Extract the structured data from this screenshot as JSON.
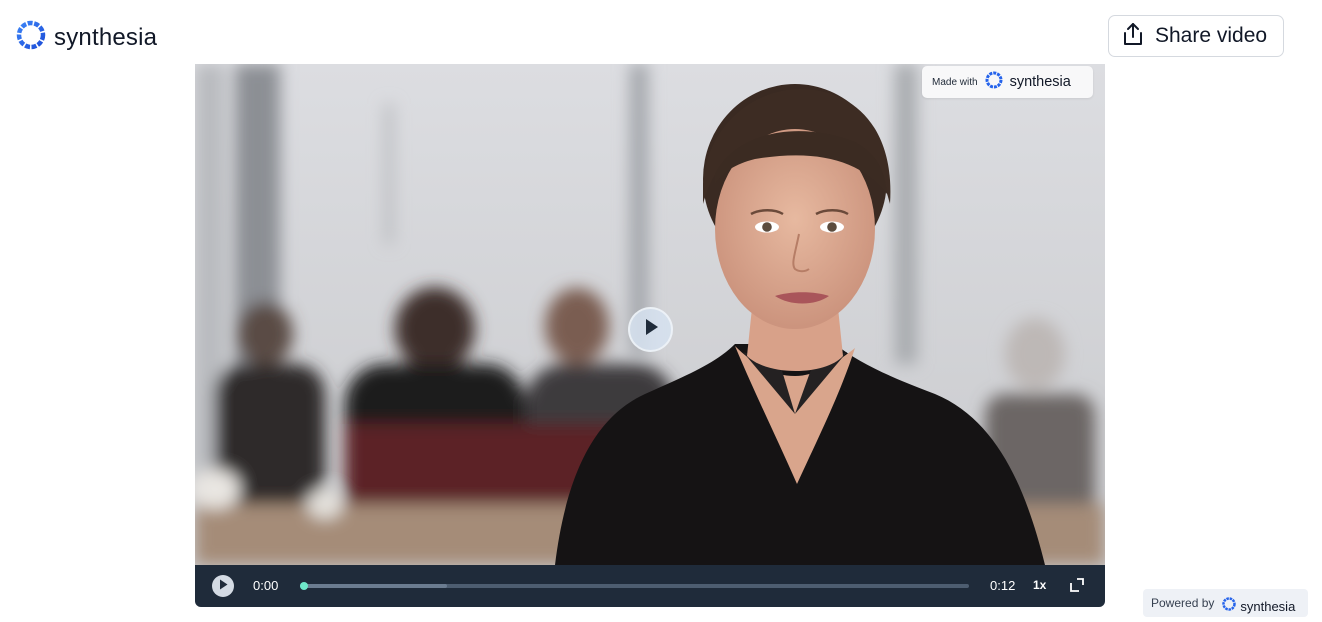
{
  "header": {
    "brand": "synthesia",
    "share_label": "Share video"
  },
  "video": {
    "watermark_prefix": "Made with",
    "watermark_brand": "synthesia",
    "current_time": "0:00",
    "duration": "0:12",
    "speed": "1x",
    "progress_fraction": 0.0,
    "buffered_fraction": 0.22
  },
  "footer": {
    "powered_label": "Powered by",
    "powered_brand": "synthesia"
  },
  "colors": {
    "brand_blue": "#2563eb",
    "controls_bg": "#1f2b3a",
    "progress_knob": "#6ee7c9"
  },
  "icons": {
    "logo": "synthesia-logo-icon",
    "share": "share-upload-icon",
    "play": "play-icon",
    "fullscreen": "fullscreen-icon"
  }
}
